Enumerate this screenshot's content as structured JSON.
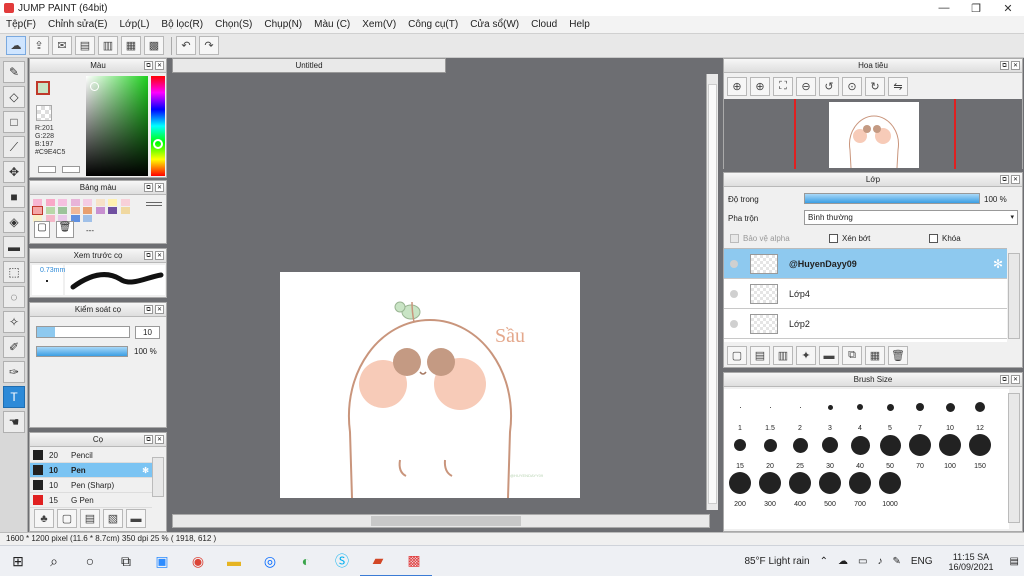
{
  "window": {
    "title": "JUMP PAINT (64bit)",
    "minimize": "—",
    "maximize": "❐",
    "close": "✕"
  },
  "menu": [
    "Tệp(F)",
    "Chỉnh sửa(E)",
    "Lớp(L)",
    "Bộ lọc(R)",
    "Chọn(S)",
    "Chụp(N)",
    "Màu (C)",
    "Xem(V)",
    "Công cụ(T)",
    "Cửa sổ(W)",
    "Cloud",
    "Help"
  ],
  "color_panel": {
    "title": "Màu",
    "r": "R:201",
    "g": "G:228",
    "b": "B:197",
    "hex": "#C9E4C5"
  },
  "palette_panel": {
    "title": "Bảng màu",
    "dash": "---"
  },
  "brush_preview": {
    "title": "Xem trước cọ",
    "size": "0.73mm"
  },
  "brush_control": {
    "title": "Kiểm soát cọ",
    "size_value": "10",
    "opacity_value": "100 %"
  },
  "brush_panel": {
    "title": "Cọ",
    "items": [
      {
        "size": "20",
        "name": "Pencil",
        "color": "#222222"
      },
      {
        "size": "10",
        "name": "Pen",
        "color": "#222222"
      },
      {
        "size": "10",
        "name": "Pen (Sharp)",
        "color": "#222222"
      },
      {
        "size": "15",
        "name": "G Pen",
        "color": "#e02020"
      }
    ]
  },
  "canvas": {
    "tab_title": "Untitled",
    "art_text": "Sầu",
    "signature": "@HUYENDAYY09"
  },
  "navigator": {
    "title": "Hoa tiêu"
  },
  "layer_panel": {
    "title": "Lớp",
    "opacity_label": "Độ trong",
    "opacity_value": "100 %",
    "opacity_fraction": 1.0,
    "blend_label": "Pha trộn",
    "blend_value": "Bình thường",
    "protect_alpha": "Bảo vệ alpha",
    "clipping": "Xén bớt",
    "lock": "Khóa",
    "layers": [
      "@HuyenDayy09",
      "Lớp4",
      "Lớp2"
    ]
  },
  "brush_size_panel": {
    "title": "Brush Size",
    "sizes": [
      "1",
      "1.5",
      "2",
      "3",
      "4",
      "5",
      "7",
      "10",
      "12",
      "15",
      "20",
      "25",
      "30",
      "40",
      "50",
      "70",
      "100",
      "150",
      "200",
      "300",
      "400",
      "500",
      "700",
      "1000"
    ]
  },
  "status": {
    "text": "1600 * 1200 pixel   (11.6 * 8.7cm)   350 dpi   25 %   ( 1918, 612 )"
  },
  "taskbar": {
    "weather": "85°F  Light rain",
    "lang": "ENG",
    "time": "11:15 SA",
    "date": "16/09/2021"
  },
  "colors": {
    "accent": "#2d8ad8",
    "layer_selected": "#8ec9ef",
    "fg_color": "#C9E4C5"
  }
}
